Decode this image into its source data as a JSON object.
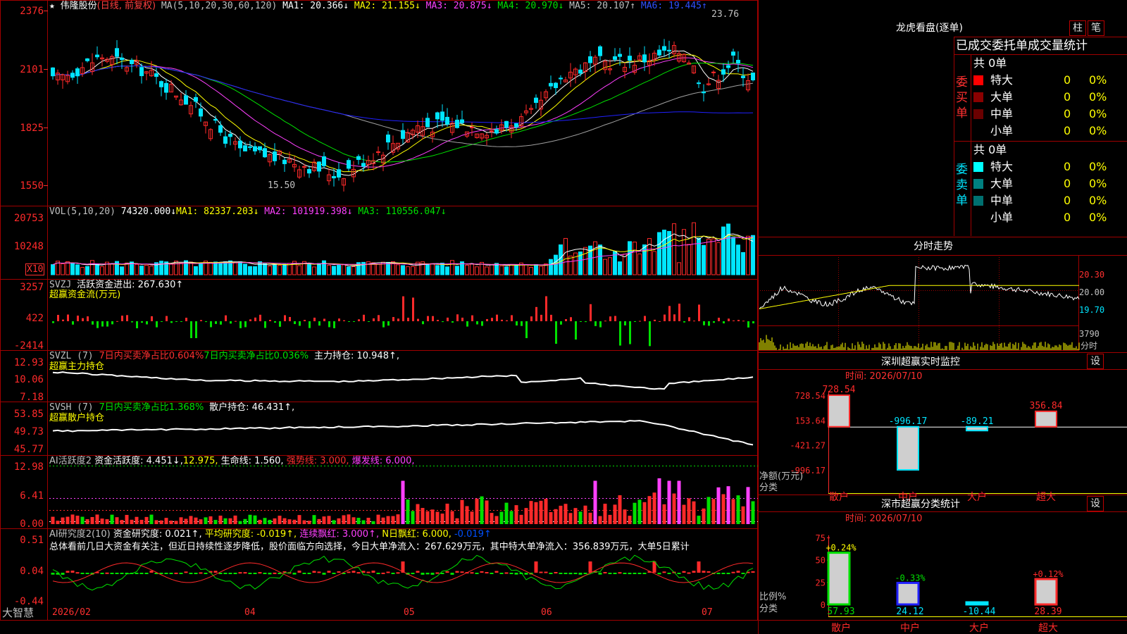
{
  "colors": {
    "up": "#ff2a2a",
    "down": "#00e5ff",
    "frame": "#a00000",
    "white": "#ffffff",
    "yellow": "#ffff00",
    "magenta": "#ff40ff",
    "green": "#00e000",
    "blue": "#2020ff",
    "gray": "#a0a0a0"
  },
  "header": {
    "star": "★",
    "title": "伟隆股份",
    "period": "(日线, 前复权)",
    "ma_params": "MA(5,10,20,30,60,120)",
    "ma_values": [
      "MA1: 20.366↓",
      "MA2: 21.155↓",
      "MA3: 20.875↓",
      "MA4: 20.970↓",
      "MA5: 20.107↑",
      "MA6: 19.445↑"
    ]
  },
  "price_panel": {
    "yticks": [
      "2376",
      "2101",
      "1825",
      "1550"
    ],
    "high_label": "23.76",
    "low_label": "15.50"
  },
  "vol_panel": {
    "label": "VOL(5,10,20)",
    "value": "74320.000↓",
    "ma": [
      "MA1: 82337.203↓",
      "MA2: 101919.398↓",
      "MA3: 110556.047↓"
    ],
    "yticks": [
      "20753",
      "10248"
    ],
    "unit": "X10"
  },
  "svzj_panel": {
    "label": "SVZJ",
    "text1": "活跃资金进出: 267.630↑",
    "text2": "超赢资金流(万元)",
    "yticks": [
      "3257",
      "422",
      "-2414"
    ]
  },
  "svzl_panel": {
    "label": "SVZL (7)",
    "t1": "7日内买卖净占比0.604%",
    "t2": "7日内买卖净占比0.036%",
    "t3": "主力持仓: 10.948↑,",
    "name": "超赢主力持仓",
    "yticks": [
      "12.93",
      "10.06",
      "7.18"
    ]
  },
  "svsh_panel": {
    "label": "SVSH (7)",
    "t1": "7日内买卖净占比1.368%",
    "t2": "散户持仓: 46.431↑,",
    "name": "超赢散户持仓",
    "yticks": [
      "53.85",
      "49.73",
      "45.77"
    ]
  },
  "ai_panel": {
    "label": "AI活跃度2",
    "t1": "资金活跃度: 4.451↓,",
    "t2": "12.975,",
    "t3": "生命线: 1.560,",
    "t4": "强势线: 3.000,",
    "t5": "爆发线: 6.000,",
    "yticks": [
      "12.98",
      "6.41",
      "0.00"
    ]
  },
  "research_panel": {
    "label": "AI研究度2(10)",
    "t1": "资金研究度: 0.021↑,",
    "t2": "平均研究度: -0.019↑,",
    "t3": "连续飘红: 3.000↑,",
    "t4": "N日飘红: 6.000,",
    "t5": "-0.019↑",
    "summary": "总体看前几日大资金有关注，但近日持续性逐步降低，股价面临方向选择，今日大单净流入：267.629万元，其中特大单净流入：356.839万元，大单5日累计",
    "yticks": [
      "0.51",
      "0.04",
      "-0.44"
    ]
  },
  "xaxis": {
    "labels": [
      "2026/02",
      "04",
      "05",
      "06",
      "07"
    ],
    "logo": "大智慧"
  },
  "lhb": {
    "title": "龙虎看盘(逐单)",
    "btn_zhu": "柱",
    "btn_bi": "笔",
    "tabs": [
      "已成交",
      "委托单",
      "成交量统计"
    ],
    "buy_label": "委买单",
    "sell_label": "委卖单",
    "buy_total": "共 0单",
    "sell_total": "共 0单",
    "buy_rows": [
      {
        "name": "特大",
        "count": "0",
        "pct": "0%"
      },
      {
        "name": "大单",
        "count": "0",
        "pct": "0%"
      },
      {
        "name": "中单",
        "count": "0",
        "pct": "0%"
      },
      {
        "name": "小单",
        "count": "0",
        "pct": "0%"
      }
    ],
    "sell_rows": [
      {
        "name": "特大",
        "count": "0",
        "pct": "0%"
      },
      {
        "name": "大单",
        "count": "0",
        "pct": "0%"
      },
      {
        "name": "中单",
        "count": "0",
        "pct": "0%"
      },
      {
        "name": "小单",
        "count": "0",
        "pct": "0%"
      }
    ]
  },
  "intraday": {
    "title": "分时走势",
    "yticks": [
      "20.30",
      "20.00",
      "19.70"
    ],
    "vol_max": "3790",
    "vol_unit": "分时"
  },
  "sz_monitor": {
    "title": "深圳超赢实时监控",
    "set_btn": "设",
    "time": "时间: 2026/07/10",
    "yticks": [
      "728.54",
      "153.64",
      "-421.27",
      "-996.17"
    ],
    "ylabel": "净额(万元)",
    "xlabel": "分类",
    "categories": [
      "散户",
      "中户",
      "大户",
      "超大"
    ],
    "values": [
      728.54,
      -996.17,
      -89.21,
      356.84
    ],
    "value_labels": [
      "728.54",
      "-996.17",
      "-89.21",
      "356.84"
    ]
  },
  "sz_class": {
    "title": "深市超赢分类统计",
    "set_btn": "设",
    "time": "时间: 2026/07/10",
    "yticks": [
      "75",
      "50",
      "25",
      "0"
    ],
    "ylabel": "比例%",
    "xlabel": "分类",
    "categories": [
      "散户",
      "中户",
      "大户",
      "超大"
    ],
    "values": [
      57.93,
      24.12,
      -10.44,
      28.39
    ],
    "bottom_labels": [
      "57.93",
      "24.12",
      "-10.44",
      "28.39"
    ],
    "top_labels": [
      "+0.24%",
      "-0.33%",
      "",
      "+0.12%"
    ]
  },
  "chart_data": [
    {
      "type": "candlestick",
      "title": "伟隆股份 (日线, 前复权)",
      "x": [
        "2026/02",
        "04",
        "05",
        "06",
        "07"
      ],
      "ylim": [
        15.5,
        23.76
      ],
      "high": 23.76,
      "low": 15.5,
      "series": [
        {
          "name": "MA1",
          "last": 20.366
        },
        {
          "name": "MA2",
          "last": 21.155
        },
        {
          "name": "MA3",
          "last": 20.875
        },
        {
          "name": "MA4",
          "last": 20.97
        },
        {
          "name": "MA5",
          "last": 20.107
        },
        {
          "name": "MA6",
          "last": 19.445
        }
      ]
    },
    {
      "type": "bar",
      "title": "深圳超赢实时监控",
      "categories": [
        "散户",
        "中户",
        "大户",
        "超大"
      ],
      "values": [
        728.54,
        -996.17,
        -89.21,
        356.84
      ],
      "ylabel": "净额(万元)",
      "xlabel": "分类",
      "ylim": [
        -996.17,
        728.54
      ]
    },
    {
      "type": "bar",
      "title": "深市超赢分类统计",
      "categories": [
        "散户",
        "中户",
        "大户",
        "超大"
      ],
      "values": [
        57.93,
        24.12,
        -10.44,
        28.39
      ],
      "ylabel": "比例%",
      "xlabel": "分类",
      "ylim": [
        0,
        75
      ]
    }
  ]
}
